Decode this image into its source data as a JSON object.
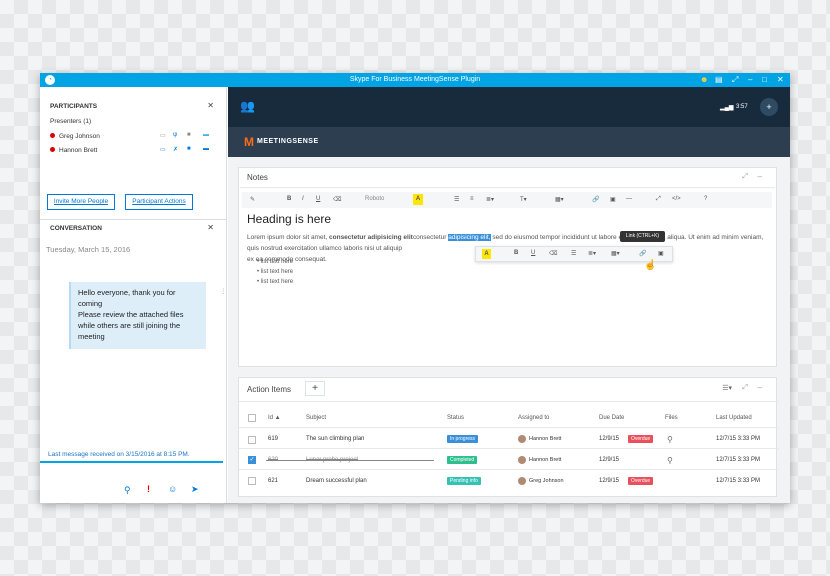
{
  "window": {
    "title": "Skype For Business MeetingSense Plugin"
  },
  "participants": {
    "header": "PARTICIPANTS",
    "presenters_label": "Presenters (1)",
    "people": [
      {
        "name": "Greg Johnson"
      },
      {
        "name": "Hannon Brett"
      }
    ],
    "invite_label": "Invite More People",
    "actions_label": "Participant Actions"
  },
  "conversation": {
    "header": "CONVERSATION",
    "date": "Tuesday, March 15, 2016",
    "message_lines": [
      "Hello everyone, thank you for coming",
      "Please review the attached files while others are still joining the meeting"
    ],
    "last_message": "Last message received on 3/15/2016 at 8:15 PM."
  },
  "topbar": {
    "time": "3:57"
  },
  "brand": {
    "logo_letter": "M",
    "name": "MEETINGSENSE"
  },
  "notes": {
    "title": "Notes",
    "font_select": "Roboto",
    "heading": "Heading is here",
    "para_before": "Lorem ipsum dolor sit amet,",
    "para_bold": "consectetur adipisicing elit",
    "para_mid": "consectetur",
    "para_selected": "adipisicing elit,",
    "para_after": "sed do eiusmod tempor incididunt ut labore et dolore magna aliqua. Ut enim ad minim veniam, quis nostrud exercitation ullamco laboris nisi ut aliquip",
    "para_line2": "ex ea commodo consequat.",
    "list": [
      "list text here",
      "list text here",
      "list text here"
    ],
    "tooltip": "Link (CTRL+K)"
  },
  "action_items": {
    "title": "Action Items",
    "add": "+",
    "columns": [
      "Id",
      "Subject",
      "Status",
      "Assigned to",
      "Due Date",
      "Files",
      "Last Updated"
    ],
    "rows": [
      {
        "id": "619",
        "subject": "The sun climbing plan",
        "status": "In progress",
        "status_color": "#3a8fd9",
        "assigned": "Hannon Brett",
        "due": "12/9/15",
        "overdue": "Overdue",
        "files": true,
        "updated": "12/7/15 3:33 PM",
        "checked": false
      },
      {
        "id": "620",
        "subject": "Lunar probe project",
        "status": "Completed",
        "status_color": "#2fbf8f",
        "assigned": "Hannon Brett",
        "due": "12/9/15",
        "overdue": "",
        "files": true,
        "updated": "12/7/15 3:33 PM",
        "checked": true
      },
      {
        "id": "621",
        "subject": "Dream successful plan",
        "status": "Pending info",
        "status_color": "#35c2b3",
        "assigned": "Greg Johnson",
        "due": "12/9/15",
        "overdue": "Overdue",
        "files": false,
        "updated": "12/7/15 3:33 PM",
        "checked": false
      }
    ]
  }
}
